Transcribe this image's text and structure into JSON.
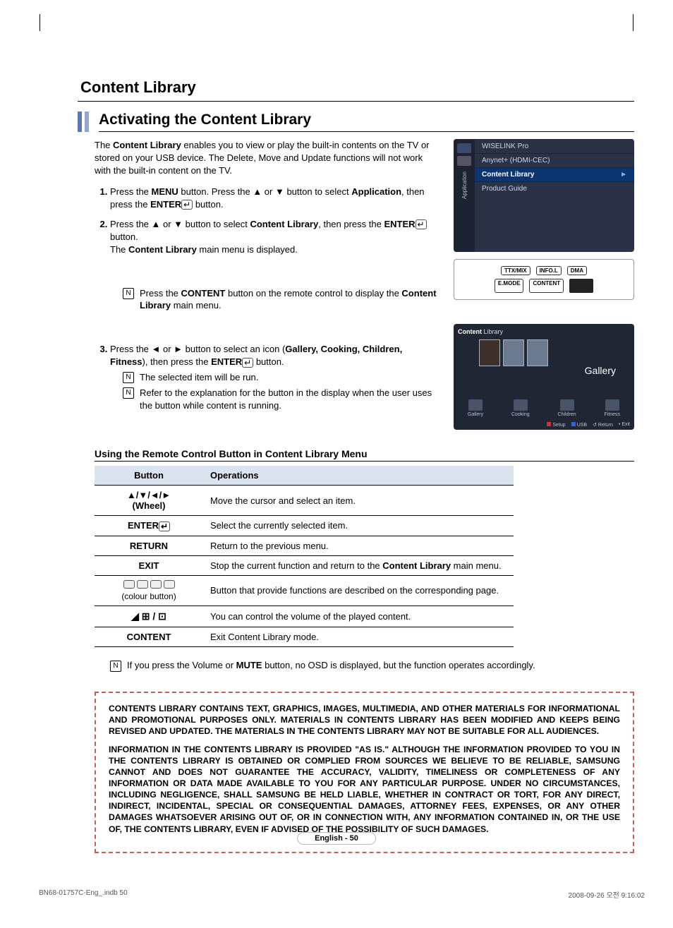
{
  "section_title": "Content Library",
  "sub_title": "Activating the Content Library",
  "intro": {
    "p1a": "The ",
    "p1b": "Content Library",
    "p1c": " enables you to view or play the built-in contents on the TV or stored on your USB device. The Delete, Move and Update functions will not work with the built-in content on the TV."
  },
  "steps": {
    "s1": {
      "a": "Press the ",
      "b": "MENU",
      "c": " button. Press the ▲ or ▼ button to select ",
      "d": "Application",
      "e": ", then press the  ",
      "f": "ENTER",
      "g": " button."
    },
    "s2": {
      "a": "Press the ▲ or ▼ button to select ",
      "b": "Content Library",
      "c": ", then press the ",
      "d": "ENTER",
      "e": " button.",
      "line2a": "The ",
      "line2b": "Content Library",
      "line2c": " main menu is displayed."
    },
    "note1": {
      "a": "Press the ",
      "b": "CONTENT",
      "c": " button on the remote control to display the ",
      "d": "Content Library",
      "e": " main menu."
    },
    "s3": {
      "a": "Press the ◄ or ► button to select an icon (",
      "b": "Gallery, Cooking, Children, Fitness",
      "c": "), then press the  ",
      "d": "ENTER",
      "e": " button."
    },
    "s3n1": "The selected item will be run.",
    "s3n2": "Refer to the explanation for the button in the display when the user uses the button while content is running."
  },
  "osd": {
    "side": "Application",
    "items": [
      "WISELINK Pro",
      "Anynet+ (HDMI-CEC)",
      "Content Library",
      "Product Guide"
    ]
  },
  "remote": {
    "r1": [
      "TTX/MIX",
      "INFO.L",
      "DMA"
    ],
    "r2": [
      "E.MODE",
      "CONTENT"
    ]
  },
  "gallery": {
    "title_a": "Content",
    "title_b": " Library",
    "label": "Gallery",
    "cats": [
      "Gallery",
      "Cooking",
      "Children",
      "Fitness"
    ],
    "foot": [
      "Setup",
      "USB",
      "Return",
      "Exit"
    ]
  },
  "table_heading": "Using the Remote Control Button in Content Library Menu",
  "table": {
    "headers": [
      "Button",
      "Operations"
    ],
    "rows": [
      {
        "btn": "▲/▼/◄/►\n(Wheel)",
        "op": "Move the cursor and select an item."
      },
      {
        "btn": "ENTER",
        "enter_icon": true,
        "op": "Select the currently selected item."
      },
      {
        "btn": "RETURN",
        "op": "Return to the previous menu."
      },
      {
        "btn": "EXIT",
        "op_a": "Stop the current function and return to the ",
        "op_b": "Content Library",
        "op_c": " main menu."
      },
      {
        "btn_colour": true,
        "btn_sub": "(colour button)",
        "op": "Button that provide functions are described on the corresponding page."
      },
      {
        "btn_vol": true,
        "op": "You can control the volume of the played content."
      },
      {
        "btn": "CONTENT",
        "op": "Exit Content Library mode."
      }
    ]
  },
  "post_note": {
    "a": "If you press the Volume or ",
    "b": "MUTE",
    "c": " button, no OSD is displayed, but the function operates accordingly."
  },
  "disclaimer": {
    "p1": "CONTENTS LIBRARY CONTAINS TEXT, GRAPHICS, IMAGES, MULTIMEDIA, AND OTHER MATERIALS FOR INFORMATIONAL AND PROMOTIONAL PURPOSES ONLY. MATERIALS IN CONTENTS LIBRARY HAS BEEN MODIFIED AND KEEPS BEING REVISED AND UPDATED.  THE MATERIALS IN THE CONTENTS LIBRARY MAY NOT BE SUITABLE FOR ALL AUDIENCES.",
    "p2": "INFORMATION IN THE CONTENTS LIBRARY IS PROVIDED \"AS IS.\" ALTHOUGH THE INFORMATION PROVIDED TO YOU IN THE CONTENTS LIBRARY IS OBTAINED OR COMPLIED FROM SOURCES WE BELIEVE TO BE RELIABLE, SAMSUNG CANNOT AND DOES NOT GUARANTEE THE ACCURACY, VALIDITY, TIMELINESS OR COMPLETENESS OF ANY INFORMATION OR DATA MADE AVAILABLE TO YOU FOR ANY PARTICULAR PURPOSE. UNDER NO CIRCUMSTANCES, INCLUDING NEGLIGENCE, SHALL SAMSUNG BE HELD LIABLE, WHETHER IN CONTRACT OR TORT, FOR ANY DIRECT, INDIRECT, INCIDENTAL, SPECIAL OR CONSEQUENTIAL DAMAGES, ATTORNEY FEES, EXPENSES, OR ANY OTHER DAMAGES WHATSOEVER ARISING OUT OF, OR IN CONNECTION WITH, ANY INFORMATION CONTAINED IN, OR THE USE OF, THE CONTENTS LIBRARY, EVEN IF ADVISED OF THE POSSIBILITY OF SUCH DAMAGES."
  },
  "page_num": "English - 50",
  "footer": {
    "left": "BN68-01757C-Eng_.indb   50",
    "right": "2008-09-26   오전 9:16:02"
  }
}
